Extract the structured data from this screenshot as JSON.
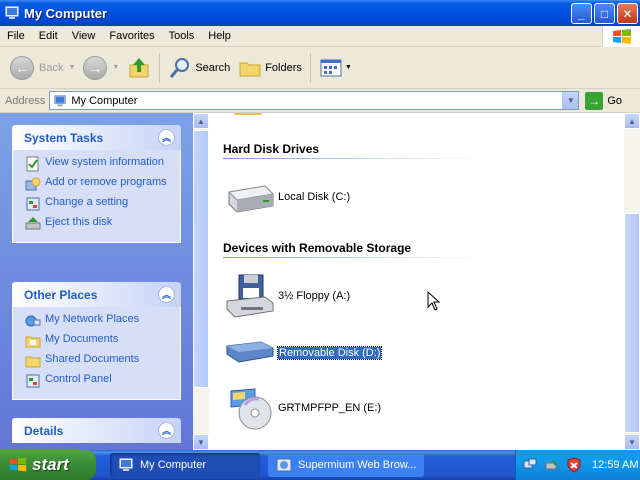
{
  "window": {
    "title": "My Computer"
  },
  "menu": [
    "File",
    "Edit",
    "View",
    "Favorites",
    "Tools",
    "Help"
  ],
  "toolbar": {
    "back_label": "Back",
    "search_label": "Search",
    "folders_label": "Folders"
  },
  "address": {
    "label": "Address",
    "value": "My Computer",
    "go_label": "Go"
  },
  "tasks": {
    "system": {
      "title": "System Tasks",
      "items": [
        "View system information",
        "Add or remove programs",
        "Change a setting",
        "Eject this disk"
      ]
    },
    "other": {
      "title": "Other Places",
      "items": [
        "My Network Places",
        "My Documents",
        "Shared Documents",
        "Control Panel"
      ]
    },
    "details": {
      "title": "Details"
    }
  },
  "content": {
    "groups": [
      {
        "title": "Hard Disk Drives",
        "items": [
          "Local Disk (C:)"
        ]
      },
      {
        "title": "Devices with Removable Storage",
        "items": [
          "3½ Floppy (A:)",
          "Removable Disk (D:)",
          "GRTMPFPP_EN (E:)"
        ]
      }
    ],
    "selected_item": "Removable Disk (D:)"
  },
  "taskbar": {
    "start_label": "start",
    "buttons": [
      "My Computer",
      "Supermium Web Brow..."
    ],
    "clock": "12:59 AM"
  }
}
